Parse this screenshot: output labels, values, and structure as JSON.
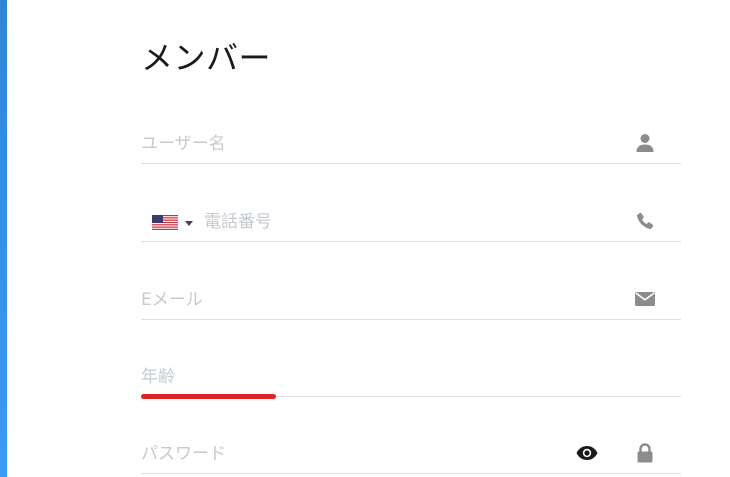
{
  "form": {
    "title": "メンバー",
    "fields": {
      "username": {
        "placeholder": "ユーザー名",
        "icon": "user-icon"
      },
      "phone": {
        "placeholder": "電話番号",
        "icon": "phone-icon",
        "country_flag": "us-flag-icon"
      },
      "email": {
        "placeholder": "Eメール",
        "icon": "envelope-icon"
      },
      "age": {
        "placeholder": "年齢",
        "progress_fraction": 0.25
      },
      "password": {
        "placeholder": "パスワード",
        "icons": [
          "eye-icon",
          "lock-icon"
        ]
      }
    }
  },
  "colors": {
    "accent_strip": "#2f86d6",
    "progress": "#e02424",
    "placeholder": "#c5cad1",
    "icon": "#8c8c8c",
    "divider": "#dcdfe3"
  }
}
